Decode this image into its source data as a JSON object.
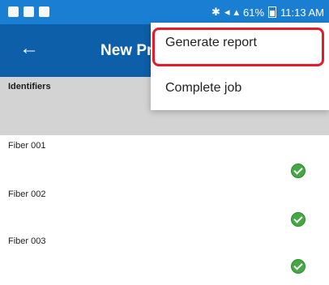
{
  "status_bar": {
    "battery": "61%",
    "time": "11:13 AM"
  },
  "app_bar": {
    "title": "New Pr",
    "back_icon": "arrow-left-icon"
  },
  "table_header": {
    "label": "Identifiers"
  },
  "rows": [
    {
      "label": "Fiber 001",
      "status_icon": "check-circle-icon"
    },
    {
      "label": "Fiber 002",
      "status_icon": "check-circle-icon"
    },
    {
      "label": "Fiber 003",
      "status_icon": "check-circle-icon"
    }
  ],
  "menu": {
    "items": [
      {
        "label": "Generate report"
      },
      {
        "label": "Complete job"
      }
    ]
  },
  "colors": {
    "status_bar": "#1a7fd3",
    "app_bar": "#0c5fa8",
    "header_band": "#d3d3d4",
    "check": "#46a845",
    "highlight": "#e21c2a"
  }
}
